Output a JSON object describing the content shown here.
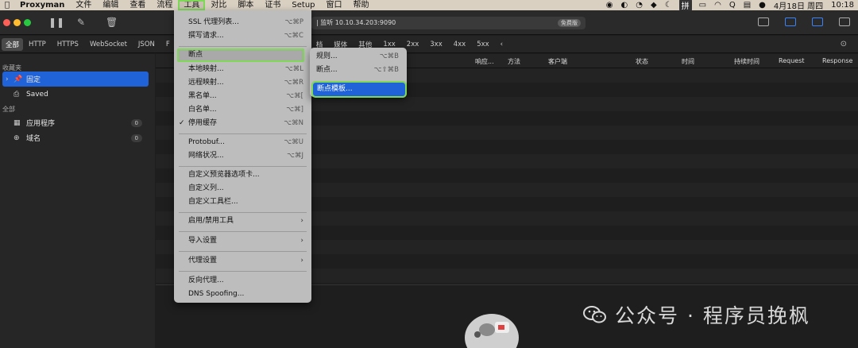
{
  "menubar": {
    "apple": "",
    "app": "Proxyman",
    "items": [
      "文件",
      "编辑",
      "查看",
      "流程",
      "工具",
      "对比",
      "脚本",
      "证书",
      "Setup",
      "窗口",
      "帮助"
    ],
    "active_index": 4,
    "status": [
      "拼",
      "Q",
      "4月18日 周四",
      "10:18"
    ]
  },
  "titlebar": {
    "address": "| 监听 10.10.34.203:9090",
    "badge": "免费版"
  },
  "filters": [
    "全部",
    "HTTP",
    "HTTPS",
    "WebSocket",
    "JSON",
    "F",
    "档",
    "媒体",
    "其他",
    "1xx",
    "2xx",
    "3xx",
    "4xx",
    "5xx",
    "‹"
  ],
  "sidebar": {
    "favorites_header": "收藏夹",
    "favorites": [
      {
        "label": "固定",
        "icon": "pin-icon",
        "selected": true
      },
      {
        "label": "Saved",
        "icon": "tray-icon",
        "selected": false
      }
    ],
    "all_header": "全部",
    "all": [
      {
        "label": "应用程序",
        "icon": "app-icon",
        "count": "0"
      },
      {
        "label": "域名",
        "icon": "globe-icon",
        "count": "0"
      }
    ]
  },
  "table": {
    "columns": [
      "响应...",
      "方法",
      "客户端",
      "状态",
      "时间",
      "持续时间",
      "Request",
      "Response"
    ]
  },
  "tools_menu": {
    "items": [
      {
        "label": "SSL 代理列表...",
        "shortcut": "⌥⌘P"
      },
      {
        "label": "撰写请求...",
        "shortcut": "⌥⌘C"
      },
      {
        "label": "断点",
        "shortcut": "",
        "highlighted": true
      },
      {
        "label": "本地映射...",
        "shortcut": "⌥⌘L"
      },
      {
        "label": "远程映射...",
        "shortcut": "⌥⌘R"
      },
      {
        "label": "黑名单...",
        "shortcut": "⌥⌘["
      },
      {
        "label": "白名单...",
        "shortcut": "⌥⌘]"
      },
      {
        "label": "停用缓存",
        "shortcut": "⌥⌘N",
        "checked": true
      },
      {
        "label": "Protobuf...",
        "shortcut": "⌥⌘U"
      },
      {
        "label": "网络状况...",
        "shortcut": "⌥⌘J"
      },
      {
        "label": "自定义预览器选项卡...",
        "shortcut": ""
      },
      {
        "label": "自定义列...",
        "shortcut": ""
      },
      {
        "label": "自定义工具栏...",
        "shortcut": ""
      },
      {
        "label": "启用/禁用工具",
        "shortcut": "",
        "submenu": true
      },
      {
        "label": "导入设置",
        "shortcut": "",
        "submenu": true
      },
      {
        "label": "代理设置",
        "shortcut": "",
        "submenu": true
      },
      {
        "label": "反向代理...",
        "shortcut": ""
      },
      {
        "label": "DNS Spoofing...",
        "shortcut": ""
      }
    ]
  },
  "breakpoint_submenu": {
    "items": [
      {
        "label": "规则...",
        "shortcut": "⌥⌘B"
      },
      {
        "label": "断点...",
        "shortcut": "⌥⇧⌘B"
      },
      {
        "label": "断点模板...",
        "shortcut": "",
        "selected": true
      }
    ]
  },
  "watermark": {
    "text": "公众号 · 程序员挽枫"
  },
  "colors": {
    "accent": "#2063d8",
    "highlight_outline": "#7fd857"
  }
}
